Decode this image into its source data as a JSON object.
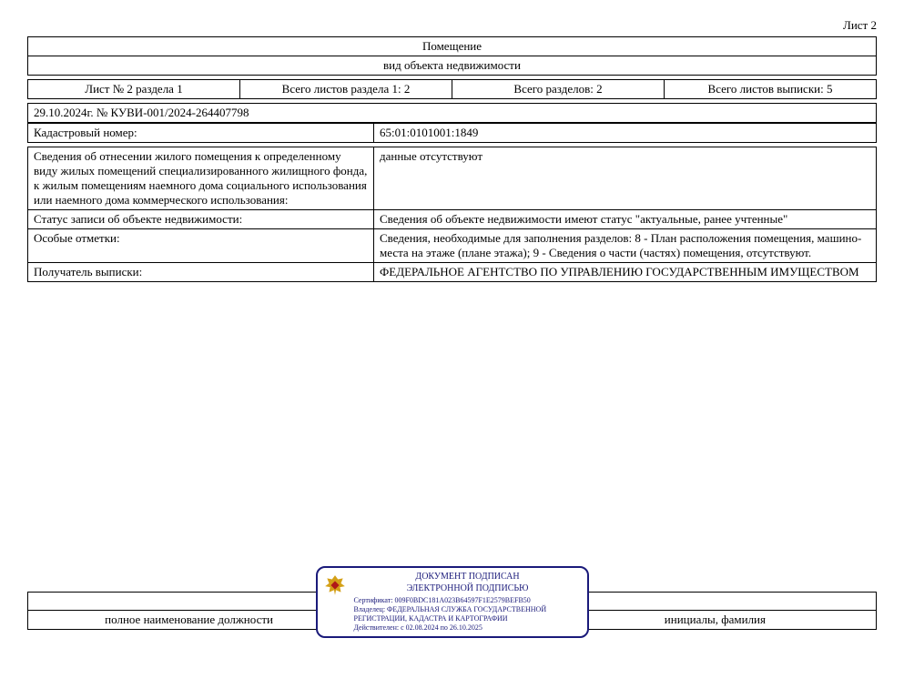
{
  "page_number_label": "Лист 2",
  "header": {
    "title": "Помещение",
    "subtitle": "вид объекта недвижимости"
  },
  "meta": {
    "sheet_section": "Лист № 2 раздела 1",
    "total_section_sheets": "Всего листов раздела 1: 2",
    "total_sections": "Всего разделов: 2",
    "total_extract_sheets": "Всего листов выписки: 5"
  },
  "doc_ref": "29.10.2024г. № КУВИ-001/2024-264407798",
  "rows": {
    "cadastral_label": "Кадастровый номер:",
    "cadastral_value": "65:01:0101001:1849",
    "housing_fund_label": "Сведения об отнесении жилого помещения к определенному виду жилых помещений специализированного жилищного фонда, к жилым помещениям наемного дома социального использования или наемного дома коммерческого использования:",
    "housing_fund_value": "данные отсутствуют",
    "status_label": "Статус записи об объекте недвижимости:",
    "status_value": "Сведения об объекте недвижимости имеют статус \"актуальные, ранее учтенные\"",
    "special_notes_label": "Особые отметки:",
    "special_notes_value": "Сведения, необходимые для заполнения разделов: 8 - План расположения помещения, машино-места на этаже (плане этажа); 9 - Сведения о части (частях) помещения, отсутствуют.",
    "recipient_label": "Получатель выписки:",
    "recipient_value": "ФЕДЕРАЛЬНОЕ АГЕНТСТВО ПО УПРАВЛЕНИЮ ГОСУДАРСТВЕННЫМ ИМУЩЕСТВОМ"
  },
  "signature": {
    "title1": "ДОКУМЕНТ ПОДПИСАН",
    "title2": "ЭЛЕКТРОННОЙ ПОДПИСЬЮ",
    "cert": "Сертификат: 009F0BDC181A023B64597F1E2579BEFB50",
    "owner": "Владелец: ФЕДЕРАЛЬНАЯ СЛУЖБА ГОСУДАРСТВЕННОЙ РЕГИСТРАЦИИ, КАДАСТРА И КАРТОГРАФИИ",
    "valid": "Действителен: с 02.08.2024 по 26.10.2025"
  },
  "footer": {
    "position_label": "полное наименование должности",
    "initials_label": "инициалы, фамилия"
  }
}
